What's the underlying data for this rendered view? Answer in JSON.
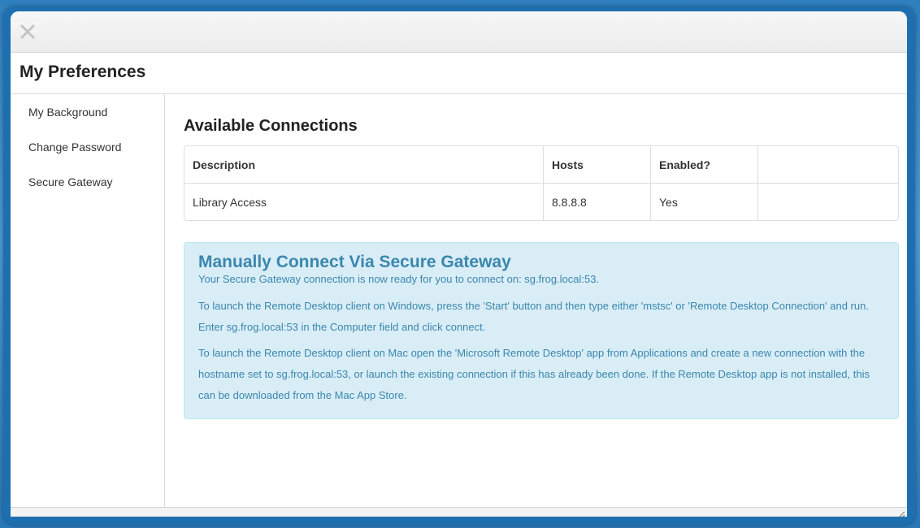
{
  "window": {
    "title": "My Preferences"
  },
  "sidebar": {
    "items": [
      {
        "label": "My Background"
      },
      {
        "label": "Change Password"
      },
      {
        "label": "Secure Gateway"
      }
    ]
  },
  "main": {
    "section_title": "Available Connections",
    "table": {
      "headers": [
        "Description",
        "Hosts",
        "Enabled?",
        ""
      ],
      "rows": [
        [
          "Library Access",
          "8.8.8.8",
          "Yes",
          ""
        ]
      ]
    },
    "info": {
      "title": "Manually Connect Via Secure Gateway",
      "lead": "Your Secure Gateway connection is now ready for you to connect on: sg.frog.local:53.",
      "windows_instructions": "To launch the Remote Desktop client on Windows, press the 'Start' button and then type either 'mstsc' or 'Remote Desktop Connection' and run. Enter sg.frog.local:53 in the Computer field and click connect.",
      "mac_instructions": "To launch the Remote Desktop client on Mac open the 'Microsoft Remote Desktop' app from Applications and create a new connection with the hostname set to sg.frog.local:53, or launch the existing connection if this has already been done. If the Remote Desktop app is not installed, this can be downloaded from the Mac App Store."
    }
  },
  "colors": {
    "frame_blue": "#1e6fb0",
    "info_bg": "#d9edf7",
    "info_text": "#3a87ad"
  },
  "icons": {
    "close": "close-icon",
    "resize": "resize-grip-icon"
  }
}
